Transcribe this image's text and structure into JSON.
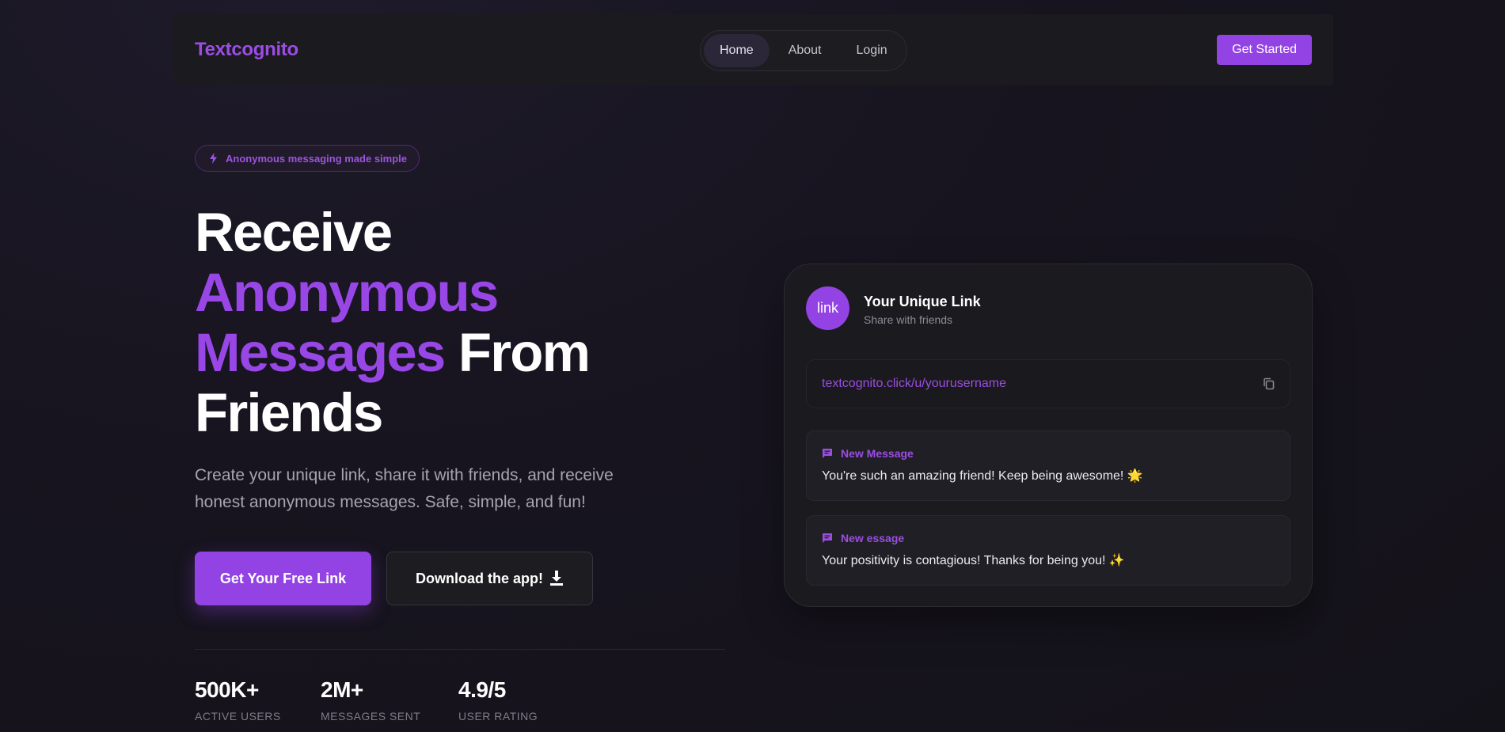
{
  "header": {
    "logo": "Textcognito",
    "nav": [
      {
        "label": "Home",
        "active": true
      },
      {
        "label": "About",
        "active": false
      },
      {
        "label": "Login",
        "active": false
      }
    ],
    "cta_label": "Get Started"
  },
  "hero": {
    "badge_text": "Anonymous messaging made simple",
    "title": {
      "line1": "Receive",
      "accent_line2": "Anonymous",
      "accent_line3": "Messages",
      "line3_rest": "From",
      "line4": "Friends"
    },
    "subtitle": "Create your unique link, share it with friends, and receive honest anonymous messages. Safe, simple, and fun!",
    "primary_button": "Get Your Free Link",
    "secondary_button": "Download the app!",
    "stats": [
      {
        "value": "500K+",
        "label": "ACTIVE USERS"
      },
      {
        "value": "2M+",
        "label": "MESSAGES SENT"
      },
      {
        "value": "4.9/5",
        "label": "USER RATING"
      }
    ]
  },
  "card": {
    "avatar_text": "link",
    "title": "Your Unique Link",
    "subtitle": "Share with friends",
    "link": "textcognito.click/u/yourusername",
    "messages": [
      {
        "heading": "New Message",
        "text": "You're such an amazing friend! Keep being awesome! 🌟"
      },
      {
        "heading": "New essage",
        "text": "Your positivity is contagious! Thanks for being you! ✨"
      }
    ]
  },
  "colors": {
    "accent": "#9343e4",
    "background": "#17141f",
    "card_background": "#1b1a1f"
  },
  "icons": {
    "badge": "lightning-icon",
    "download": "download-icon",
    "copy": "copy-icon",
    "message": "message-icon"
  }
}
